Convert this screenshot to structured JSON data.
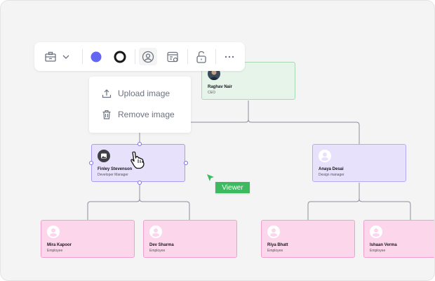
{
  "toolbar": {
    "items": [
      {
        "icon": "id-card-icon"
      },
      {
        "icon": "chevron-down-icon"
      },
      {
        "icon": "fill-color-swatch",
        "color": "#6366f1"
      },
      {
        "icon": "stroke-color-swatch",
        "color": "#18181b"
      },
      {
        "icon": "user-avatar-icon",
        "active": true
      },
      {
        "icon": "card-settings-icon"
      },
      {
        "icon": "unlock-icon"
      },
      {
        "icon": "more-icon"
      }
    ]
  },
  "menu": {
    "items": [
      {
        "label": "Upload image",
        "icon": "upload-icon"
      },
      {
        "label": "Remove image",
        "icon": "trash-icon"
      }
    ]
  },
  "nodes": {
    "ceo": {
      "name": "Raghav Nair",
      "role": "CEO",
      "color": "#e6f4ea"
    },
    "finley": {
      "name": "Finley Stevenson",
      "role": "Developer Manager",
      "selected": true
    },
    "anaya": {
      "name": "Anaya Desai",
      "role": "Design manager"
    },
    "mira": {
      "name": "Mira Kapoor",
      "role": "Employee"
    },
    "dev": {
      "name": "Dev Sharma",
      "role": "Employee"
    },
    "riya": {
      "name": "Riya Bhatt",
      "role": "Employee"
    },
    "ishaan": {
      "name": "Ishaan Verma",
      "role": "Employee"
    }
  },
  "collaborator": {
    "label": "Viewer",
    "color": "#3dba5f"
  }
}
